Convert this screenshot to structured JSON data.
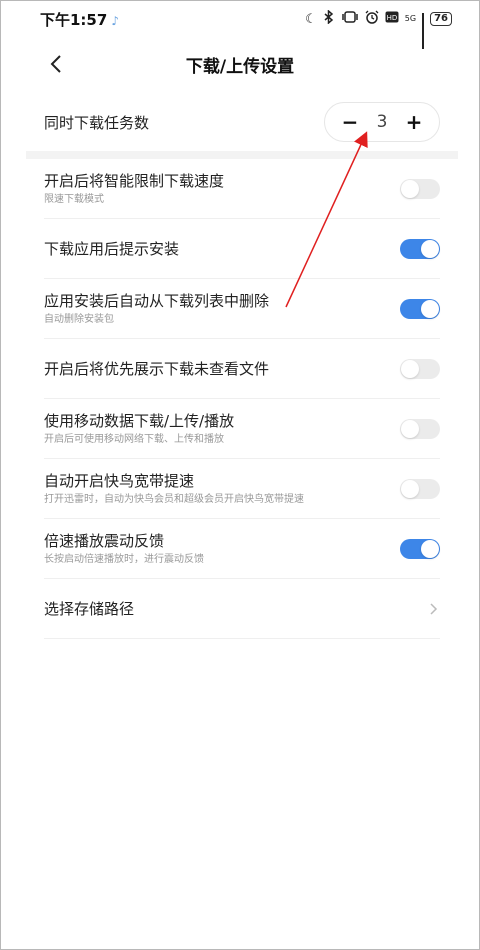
{
  "status_bar": {
    "time": "下午1:57",
    "network": "5G",
    "battery": "76"
  },
  "header": {
    "title": "下载/上传设置"
  },
  "concurrent": {
    "label": "同时下载任务数",
    "minus": "−",
    "value": "3",
    "plus": "+"
  },
  "settings": [
    {
      "title": "开启后将智能限制下载速度",
      "sub": "限速下载模式",
      "on": false
    },
    {
      "title": "下载应用后提示安装",
      "sub": "",
      "on": true
    },
    {
      "title": "应用安装后自动从下载列表中删除",
      "sub": "自动删除安装包",
      "on": true
    },
    {
      "title": "开启后将优先展示下载未查看文件",
      "sub": "",
      "on": false
    },
    {
      "title": "使用移动数据下载/上传/播放",
      "sub": "开启后可使用移动网络下载、上传和播放",
      "on": false
    },
    {
      "title": "自动开启快鸟宽带提速",
      "sub": "打开迅雷时，自动为快鸟会员和超级会员开启快鸟宽带提速",
      "on": false
    },
    {
      "title": "倍速播放震动反馈",
      "sub": "长按启动倍速播放时，进行震动反馈",
      "on": true
    }
  ],
  "storage": {
    "label": "选择存储路径"
  },
  "colors": {
    "toggle_on": "#3d86e8",
    "toggle_off": "#ebebeb",
    "annotation_arrow": "#e02020"
  }
}
